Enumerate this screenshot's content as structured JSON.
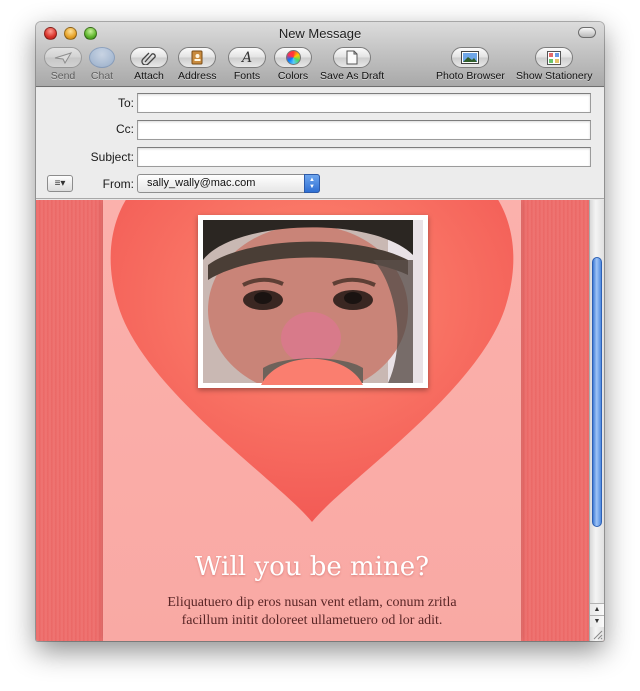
{
  "window": {
    "title": "New Message"
  },
  "toolbar": {
    "items": [
      {
        "label": "Send",
        "icon": "paper-plane-icon",
        "enabled": false
      },
      {
        "label": "Chat",
        "icon": "chat-bubble-icon",
        "enabled": false
      },
      {
        "label": "Attach",
        "icon": "paperclip-icon",
        "enabled": true
      },
      {
        "label": "Address",
        "icon": "address-book-icon",
        "enabled": true
      },
      {
        "label": "Fonts",
        "icon": "font-icon",
        "enabled": true
      },
      {
        "label": "Colors",
        "icon": "color-wheel-icon",
        "enabled": true
      },
      {
        "label": "Save As Draft",
        "icon": "draft-icon",
        "enabled": true
      },
      {
        "label": "Photo Browser",
        "icon": "photo-icon",
        "enabled": true
      },
      {
        "label": "Show Stationery",
        "icon": "stationery-icon",
        "enabled": true
      }
    ]
  },
  "headers": {
    "to_label": "To:",
    "to_value": "",
    "cc_label": "Cc:",
    "cc_value": "",
    "subject_label": "Subject:",
    "subject_value": "",
    "from_label": "From:",
    "from_value": "sally_wally@mac.com",
    "menu_glyph": "≡▾"
  },
  "message": {
    "headline": "Will you be mine?",
    "body": "Eliquatuero dip eros nusan vent etlam, conum zritla facillum initit doloreet ullametuero od lor adit."
  },
  "colors": {
    "stationery_red": "#ec6a68",
    "paper_pink": "#fbb1ac",
    "heart_red": "#f4625b",
    "scroll_blue": "#3e7ad6"
  }
}
